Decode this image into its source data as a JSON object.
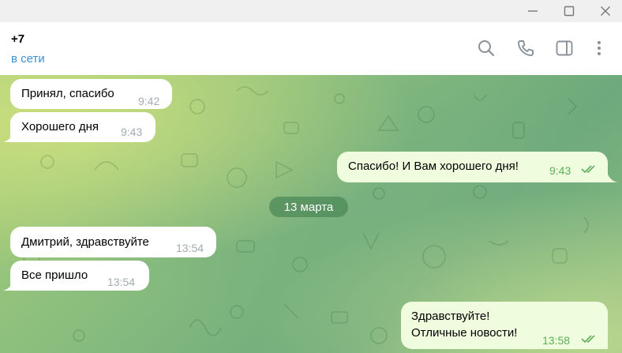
{
  "window": {
    "controls": [
      "minimize",
      "maximize",
      "close"
    ]
  },
  "header": {
    "contact_name": "+7",
    "status": "в сети",
    "icons": [
      "search-icon",
      "phone-icon",
      "sidebar-toggle-icon",
      "more-icon"
    ]
  },
  "messages": [
    {
      "direction": "in",
      "text": "Принял, спасибо",
      "time": "9:42"
    },
    {
      "direction": "in",
      "text": "Хорошего дня",
      "time": "9:43"
    },
    {
      "direction": "out",
      "text": "Спасибо! И Вам хорошего дня!",
      "time": "9:43",
      "read": true
    },
    {
      "direction": "in",
      "text": "Дмитрий, здравствуйте",
      "time": "13:54"
    },
    {
      "direction": "in",
      "text": "Все пришло",
      "time": "13:54"
    },
    {
      "direction": "out",
      "text_lines": [
        "Здравствуйте!",
        "Отличные новости!"
      ],
      "time": "13:58",
      "read": true
    }
  ],
  "date_separator": "13 марта",
  "colors": {
    "status": "#3a8fd6",
    "incoming_bubble": "#ffffff",
    "outgoing_bubble": "#effdde",
    "outgoing_time": "#5fae5b",
    "date_pill": "#4c8a58"
  }
}
